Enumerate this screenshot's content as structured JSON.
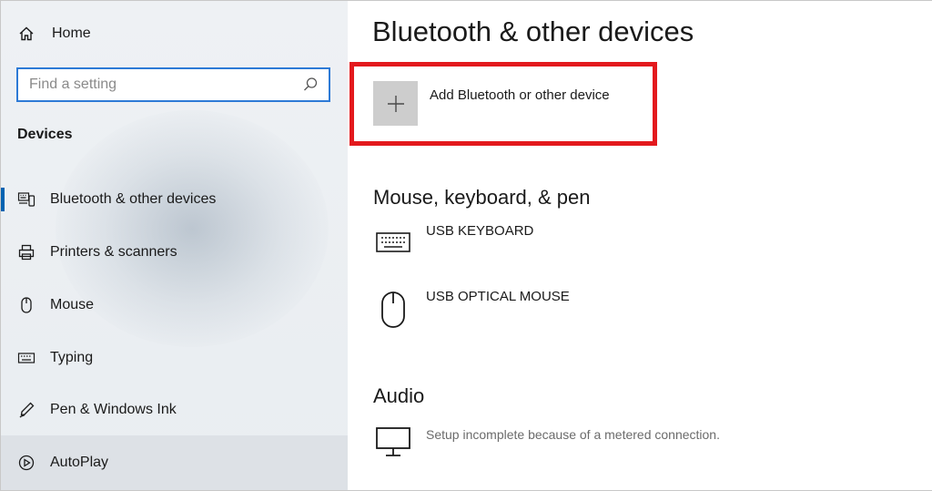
{
  "sidebar": {
    "home_label": "Home",
    "search": {
      "placeholder": "Find a setting",
      "value": ""
    },
    "section_label": "Devices",
    "items": [
      {
        "label": "Bluetooth & other devices",
        "icon": "bluetooth-devices-icon",
        "selected": true
      },
      {
        "label": "Printers & scanners",
        "icon": "printer-icon"
      },
      {
        "label": "Mouse",
        "icon": "mouse-icon"
      },
      {
        "label": "Typing",
        "icon": "keyboard-icon"
      },
      {
        "label": "Pen & Windows Ink",
        "icon": "pen-icon"
      },
      {
        "label": "AutoPlay",
        "icon": "autoplay-icon"
      }
    ]
  },
  "main": {
    "title": "Bluetooth & other devices",
    "add_device_label": "Add Bluetooth or other device",
    "groups": [
      {
        "title": "Mouse, keyboard, & pen",
        "devices": [
          {
            "name": "USB KEYBOARD",
            "icon": "keyboard-icon",
            "status": ""
          },
          {
            "name": "USB OPTICAL MOUSE",
            "icon": "mouse-icon",
            "status": ""
          }
        ]
      },
      {
        "title": "Audio",
        "devices": [
          {
            "name": "",
            "icon": "monitor-icon",
            "status": "Setup incomplete because of a metered connection."
          }
        ]
      }
    ]
  },
  "colors": {
    "accent": "#0063b1",
    "search_border": "#2d7ad6",
    "highlight_border": "#e3191d",
    "sidebar_bg": "#e9edf1",
    "add_tile_bg": "#cdcdcd"
  }
}
